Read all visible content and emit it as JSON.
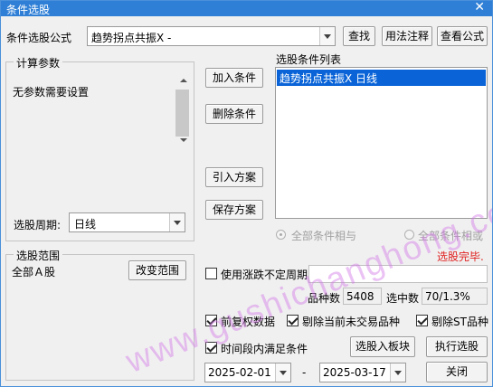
{
  "window": {
    "title": "条件选股",
    "close_glyph": "✕"
  },
  "formula": {
    "label": "条件选股公式",
    "value": "趋势拐点共振X  -",
    "find": "查找",
    "usage": "用法注释",
    "view": "查看公式"
  },
  "params": {
    "group": "计算参数",
    "text": "无参数需要设置",
    "period_label": "选股周期:",
    "period_value": "日线"
  },
  "actions": {
    "add": "加入条件",
    "remove": "删除条件",
    "import": "引入方案",
    "save": "保存方案"
  },
  "conditions": {
    "title": "选股条件列表",
    "items": [
      "趋势拐点共振X  日线"
    ],
    "and_label": "全部条件相与",
    "or_label": "全部条件相或",
    "status": "选股完毕."
  },
  "scope": {
    "group": "选股范围",
    "value": "全部Ａ股",
    "change": "改变范围"
  },
  "options": {
    "volatile_label": "使用涨跌不定周期",
    "count_label": "品种数",
    "count_value": "5408",
    "hit_label": "选中数",
    "hit_value": "70/1.3%",
    "pre_adjust": "前复权数据",
    "exclude_untraded": "剔除当前未交易品种",
    "exclude_st": "剔除ST品种",
    "period_cond": "时间段内满足条件",
    "to_block": "选股入板块",
    "run": "执行选股",
    "date_from": "2025-02-01",
    "dash": "-",
    "date_to": "2025-03-17",
    "close": "关闭"
  },
  "watermark": "www.gushichanghong.com",
  "colors": {
    "title_bar": "#2f7fd6",
    "selection": "#0a64d8",
    "status": "#e02020"
  }
}
